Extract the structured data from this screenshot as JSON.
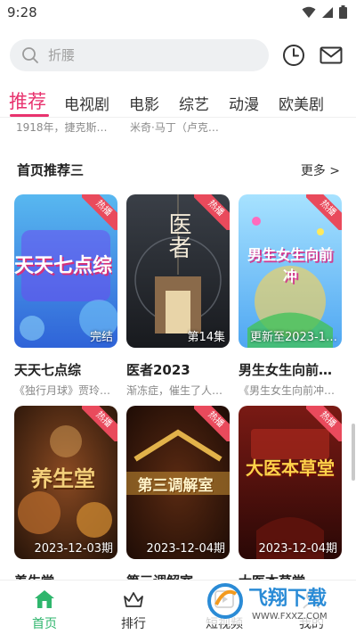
{
  "status": {
    "time": "9:28"
  },
  "search": {
    "placeholder": "折腰"
  },
  "tabs": [
    {
      "label": "推荐"
    },
    {
      "label": "电视剧"
    },
    {
      "label": "电影"
    },
    {
      "label": "综艺"
    },
    {
      "label": "动漫"
    },
    {
      "label": "欧美剧"
    }
  ],
  "partial_row": [
    "1918年，捷克斯…",
    "米奇·马丁（卢克…"
  ],
  "section": {
    "title": "首页推荐三",
    "more": "更多 >"
  },
  "cards": [
    {
      "badge": "热播",
      "ep": "完结",
      "title": "天天七点综",
      "desc": "《独行月球》贾玲…",
      "poster_text": "天天七点综"
    },
    {
      "badge": "热播",
      "ep": "第14集",
      "title": "医者2023",
      "desc": "渐冻症，催生了人…",
      "poster_text": "医者"
    },
    {
      "badge": "热播",
      "ep": "更新至2023-1…",
      "title": "男生女生向前…",
      "desc": "《男生女生向前冲…",
      "poster_text": "男生女生向前冲"
    },
    {
      "badge": "热播",
      "ep": "2023-12-03期",
      "title": "养生堂",
      "desc": "",
      "poster_text": "养生堂"
    },
    {
      "badge": "热播",
      "ep": "2023-12-04期",
      "title": "第三调解室",
      "desc": "",
      "poster_text": "第三调解室"
    },
    {
      "badge": "热播",
      "ep": "2023-12-04期",
      "title": "大医本草堂",
      "desc": "",
      "poster_text": "大医本草堂"
    }
  ],
  "bottom_nav": [
    {
      "label": "首页"
    },
    {
      "label": "排行"
    },
    {
      "label": "短视频"
    },
    {
      "label": "我的"
    }
  ],
  "watermark": {
    "text": "飞翔下载",
    "url": "WWW.FXXZ.COM"
  },
  "colors": {
    "accent": "#e8336e",
    "nav_active": "#2fb66d",
    "hot_badge": "#e94a5c"
  }
}
